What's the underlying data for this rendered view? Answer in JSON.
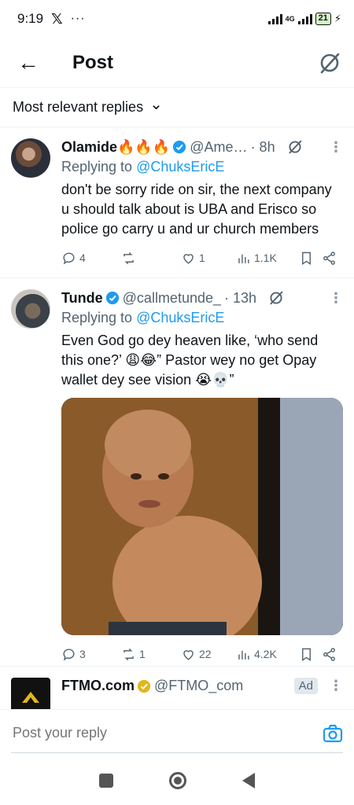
{
  "status": {
    "time": "9:19",
    "x_logo": "𝕏",
    "dots": "···",
    "network": "4G",
    "battery": "21",
    "bolt": "⚡"
  },
  "header": {
    "back_icon": "←",
    "title": "Post"
  },
  "sort": {
    "label": "Most relevant replies",
    "chevron": "⌄"
  },
  "tweets": [
    {
      "name": "Olamide🔥🔥🔥",
      "handle": "@Ame…",
      "time": "· 8h",
      "replying_prefix": "Replying to ",
      "replying_to": "@ChuksEricE",
      "text": "don't be sorry ride on sir, the next company u should talk about is UBA and Erisco so police go carry u and ur church members",
      "replies": "4",
      "retweets": "",
      "likes": "1",
      "views": "1.1K"
    },
    {
      "name": "Tunde",
      "handle": "@callmetunde_",
      "time": "· 13h",
      "replying_prefix": "Replying to ",
      "replying_to": "@ChuksEricE",
      "text": "Even God go dey heaven like, ‘who send this one?’ 😩😂” Pastor wey no get Opay wallet dey see vision  😭💀”",
      "replies": "3",
      "retweets": "1",
      "likes": "22",
      "views": "4.2K"
    },
    {
      "name": "FTMO.com",
      "handle": "@FTMO_com",
      "ad_label": "Ad"
    }
  ],
  "reply_bar": {
    "placeholder": "Post your reply"
  },
  "colors": {
    "accent": "#1d9bf0",
    "secondary_text": "#536471",
    "gold_verified": "#e2b719"
  }
}
